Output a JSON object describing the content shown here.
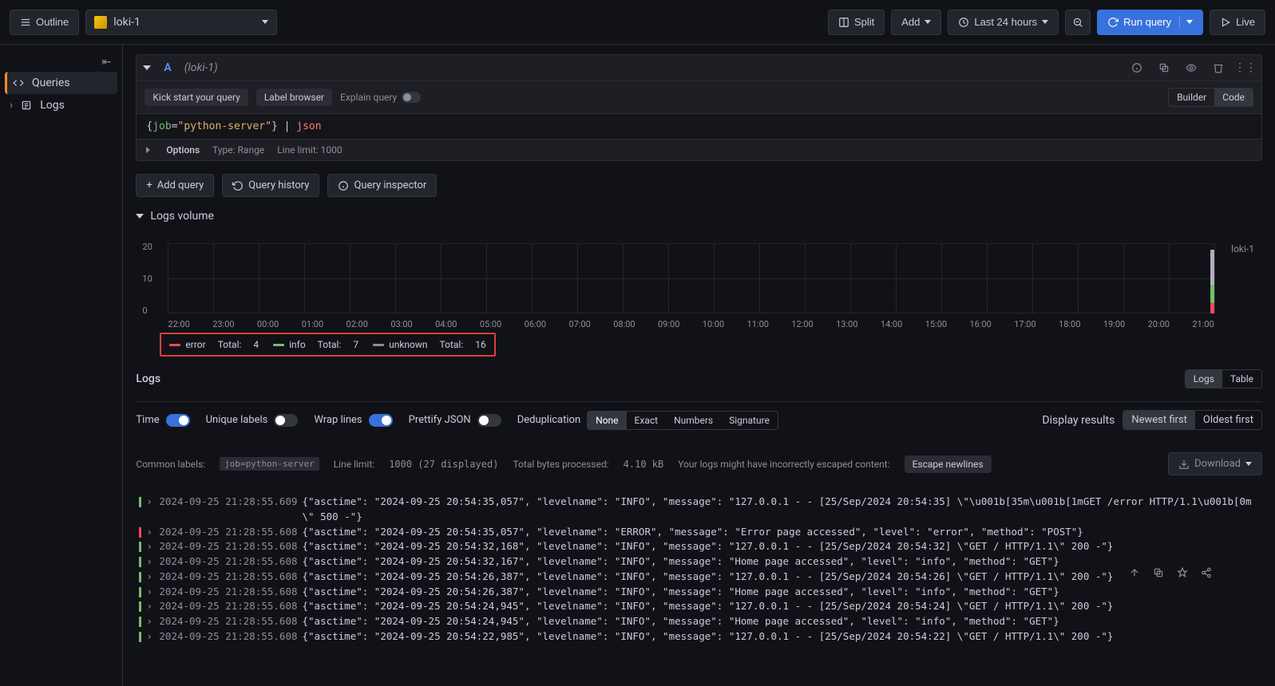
{
  "topbar": {
    "outline": "Outline",
    "datasource": "loki-1",
    "split": "Split",
    "add": "Add",
    "timerange": "Last 24 hours",
    "runquery": "Run query",
    "live": "Live"
  },
  "sidebar": {
    "queries": "Queries",
    "logs": "Logs"
  },
  "query": {
    "letter": "A",
    "src": "(loki-1)",
    "kickstart": "Kick start your query",
    "labelbrowser": "Label browser",
    "explain": "Explain query",
    "builder": "Builder",
    "code": "Code",
    "expr": "{job=\"python-server\"} | json",
    "options": "Options",
    "type": "Type: Range",
    "linelimit": "Line limit: 1000"
  },
  "actions": {
    "addquery": "Add query",
    "history": "Query history",
    "inspector": "Query inspector"
  },
  "volume": {
    "title": "Logs volume",
    "source": "loki-1"
  },
  "chart_data": {
    "type": "bar",
    "x_ticks": [
      "22:00",
      "23:00",
      "00:00",
      "01:00",
      "02:00",
      "03:00",
      "04:00",
      "05:00",
      "06:00",
      "07:00",
      "08:00",
      "09:00",
      "10:00",
      "11:00",
      "12:00",
      "13:00",
      "14:00",
      "15:00",
      "16:00",
      "17:00",
      "18:00",
      "19:00",
      "20:00",
      "21:00"
    ],
    "y_ticks": [
      0,
      10,
      20
    ],
    "ylim": [
      0,
      25
    ],
    "series": [
      {
        "name": "error",
        "color": "#f2495c",
        "total": 4
      },
      {
        "name": "info",
        "color": "#73bf69",
        "total": 7
      },
      {
        "name": "unknown",
        "color": "#8e8e9a",
        "total": 16
      }
    ],
    "legend_labels": {
      "error": "error",
      "info": "info",
      "unknown": "unknown",
      "total": "Total:"
    },
    "note": "Bars appear only near the rightmost bucket (~21:00) as a small stacked column; error≈4, info≈7, unknown≈16."
  },
  "logs_section": {
    "title": "Logs",
    "tab_logs": "Logs",
    "tab_table": "Table"
  },
  "controls": {
    "time": "Time",
    "unique": "Unique labels",
    "wrap": "Wrap lines",
    "prettify": "Prettify JSON",
    "dedup": "Deduplication",
    "dedup_opts": {
      "none": "None",
      "exact": "Exact",
      "numbers": "Numbers",
      "sig": "Signature"
    },
    "display_results": "Display results",
    "newest": "Newest first",
    "oldest": "Oldest first"
  },
  "info": {
    "common": "Common labels:",
    "common_tag": "job=python-server",
    "linelimit_label": "Line limit:",
    "linelimit_value": "1000 (27 displayed)",
    "bytes_label": "Total bytes processed:",
    "bytes_value": "4.10 kB",
    "escaped": "Your logs might have incorrectly escaped content:",
    "escape_btn": "Escape newlines",
    "download": "Download"
  },
  "logs": [
    {
      "level": "info",
      "ts": "2024-09-25 21:28:55.609",
      "body": "{\"asctime\": \"2024-09-25 20:54:35,057\", \"levelname\": \"INFO\", \"message\": \"127.0.0.1 - - [25/Sep/2024 20:54:35] \\\"\\u001b[35m\\u001b[1mGET /error HTTP/1.1\\u001b[0m\\\" 500 -\"}"
    },
    {
      "level": "error",
      "ts": "2024-09-25 21:28:55.608",
      "body": "{\"asctime\": \"2024-09-25 20:54:35,057\", \"levelname\": \"ERROR\", \"message\": \"Error page accessed\", \"level\": \"error\", \"method\": \"POST\"}"
    },
    {
      "level": "info",
      "ts": "2024-09-25 21:28:55.608",
      "body": "{\"asctime\": \"2024-09-25 20:54:32,168\", \"levelname\": \"INFO\", \"message\": \"127.0.0.1 - - [25/Sep/2024 20:54:32] \\\"GET / HTTP/1.1\\\" 200 -\"}"
    },
    {
      "level": "info",
      "ts": "2024-09-25 21:28:55.608",
      "body": "{\"asctime\": \"2024-09-25 20:54:32,167\", \"levelname\": \"INFO\", \"message\": \"Home page accessed\", \"level\": \"info\", \"method\": \"GET\"}"
    },
    {
      "level": "info",
      "ts": "2024-09-25 21:28:55.608",
      "body": "{\"asctime\": \"2024-09-25 20:54:26,387\", \"levelname\": \"INFO\", \"message\": \"127.0.0.1 - - [25/Sep/2024 20:54:26] \\\"GET / HTTP/1.1\\\" 200 -\"}"
    },
    {
      "level": "info",
      "ts": "2024-09-25 21:28:55.608",
      "body": "{\"asctime\": \"2024-09-25 20:54:26,387\", \"levelname\": \"INFO\", \"message\": \"Home page accessed\", \"level\": \"info\", \"method\": \"GET\"}"
    },
    {
      "level": "info",
      "ts": "2024-09-25 21:28:55.608",
      "body": "{\"asctime\": \"2024-09-25 20:54:24,945\", \"levelname\": \"INFO\", \"message\": \"127.0.0.1 - - [25/Sep/2024 20:54:24] \\\"GET / HTTP/1.1\\\" 200 -\"}"
    },
    {
      "level": "info",
      "ts": "2024-09-25 21:28:55.608",
      "body": "{\"asctime\": \"2024-09-25 20:54:24,945\", \"levelname\": \"INFO\", \"message\": \"Home page accessed\", \"level\": \"info\", \"method\": \"GET\"}"
    },
    {
      "level": "info",
      "ts": "2024-09-25 21:28:55.608",
      "body": "{\"asctime\": \"2024-09-25 20:54:22,985\", \"levelname\": \"INFO\", \"message\": \"127.0.0.1 - - [25/Sep/2024 20:54:22] \\\"GET / HTTP/1.1\\\" 200 -\"}"
    }
  ]
}
